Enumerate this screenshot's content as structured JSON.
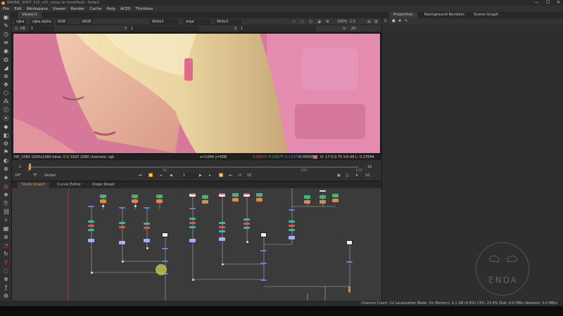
{
  "titlebar": {
    "title": "BARBIE_SHOT_010_v01_comp.nk (modified) - NukeX"
  },
  "window_controls": [
    "—",
    "☐",
    "✕"
  ],
  "menubar": [
    "File",
    "Edit",
    "Workspace",
    "Viewer",
    "Render",
    "Cache",
    "Help",
    "ACES",
    "Thinkbox"
  ],
  "viewer": {
    "tab": "Viewer1",
    "controls1": {
      "channels": "rgba",
      "layer": "rgba.alpha",
      "colorspace": "RGB",
      "display": "sRGB",
      "input_a": "Write3",
      "op": "wipe",
      "input_b": "Write3",
      "zoom": "330%",
      "ratio": "1:1",
      "mode": "2D"
    },
    "controls2": {
      "frame_range": "f/8",
      "f_value": "1",
      "y_label": "Y",
      "y_value": "1",
      "s_label": "S",
      "s_value": "1"
    },
    "info": {
      "format": "HD_1080 1920x1080  bbox: 0 0 1920 1080 channels: rgb",
      "coords": "x=1094 y=606",
      "r": "0.49107",
      "g": "0.23077",
      "b": "0.12479",
      "a": "0.00000",
      "hsvl": "H: 17 S:0.75 V:0.49  L: 0.27644"
    },
    "image_colors": {
      "accent": "#d47396"
    }
  },
  "timeline": {
    "start": "1",
    "end": "10",
    "ticks": [
      "1",
      "50",
      "100",
      "120"
    ],
    "fps": "24*",
    "tf": "TF",
    "scope": "Global",
    "current_frame": "1",
    "step": "10",
    "end_frame_box": "10"
  },
  "panel_tabs": [
    "Node Graph",
    "Curve Editor",
    "Dope Sheet"
  ],
  "properties": {
    "tabs": [
      "Properties",
      "Background Renders",
      "Scene Graph"
    ],
    "count": "2"
  },
  "statusbar": {
    "text": "Channel Count: 22  Localization Mode: On  Memory: 3.1 GB (4.9%)  CPU: 23.4%  Disk: 6.6 MB/s  Network: 0.0 MB/s"
  },
  "watermark": {
    "text": "ENDA"
  },
  "colors": {
    "node_green": "#4caf7a",
    "node_orange": "#d88c4a",
    "node_blue": "#6a7fd6",
    "node_teal": "#3fb8a0",
    "node_red": "#d8555a"
  }
}
